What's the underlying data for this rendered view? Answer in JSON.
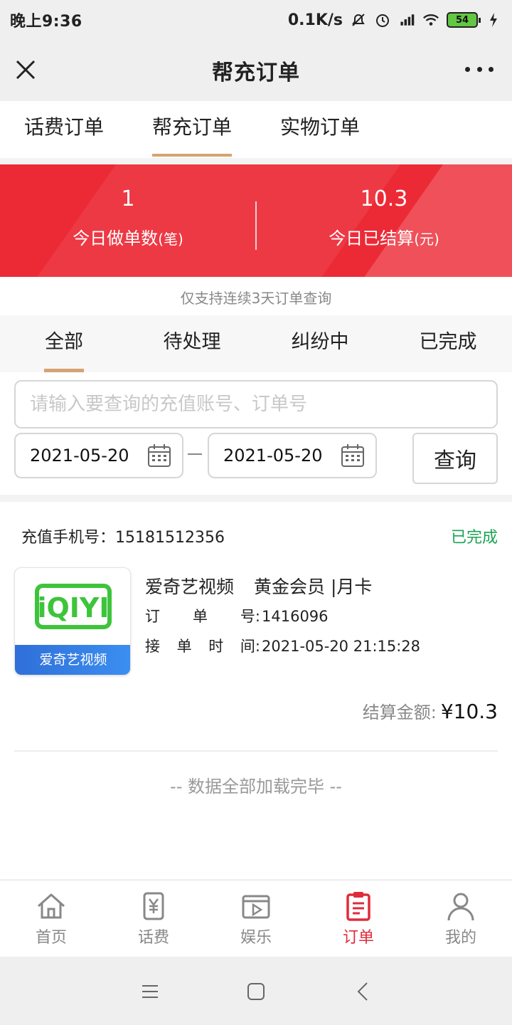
{
  "status_bar": {
    "time": "晚上9:36",
    "net_speed": "0.1K/s",
    "battery": "54"
  },
  "header": {
    "title": "帮充订单",
    "close_icon": "close-icon",
    "more_icon": "more-icon"
  },
  "top_tabs": [
    {
      "label": "话费订单",
      "active": false
    },
    {
      "label": "帮充订单",
      "active": true
    },
    {
      "label": "实物订单",
      "active": false
    }
  ],
  "summary": {
    "orders_today_value": "1",
    "orders_today_label": "今日做单数",
    "orders_today_unit": "(笔)",
    "settled_today_value": "10.3",
    "settled_today_label": "今日已结算",
    "settled_today_unit": "(元)",
    "accent_color": "#ec2a36"
  },
  "notice": "仅支持连续3天订单查询",
  "status_tabs": [
    {
      "label": "全部",
      "active": true
    },
    {
      "label": "待处理",
      "active": false
    },
    {
      "label": "纠纷中",
      "active": false
    },
    {
      "label": "已完成",
      "active": false
    }
  ],
  "filter": {
    "search_placeholder": "请输入要查询的充值账号、订单号",
    "start_date": "2021-05-20",
    "end_date": "2021-05-20",
    "query_label": "查询"
  },
  "order": {
    "phone_label": "充值手机号：",
    "phone": "15181512356",
    "status": "已完成",
    "status_color": "#1aa352",
    "thumb_logo": "iQIYI",
    "thumb_caption": "爱奇艺视频",
    "product_name": "爱奇艺视频",
    "product_spec": "黄金会员 |月卡",
    "order_no_label_chars": [
      "订",
      "单",
      "号"
    ],
    "order_no": "1416096",
    "time_label_chars": [
      "接",
      "单",
      "时",
      "间"
    ],
    "time": "2021-05-20 21:15:28",
    "settle_label": "结算金额:",
    "settle_amount": "¥10.3"
  },
  "end_text": "-- 数据全部加载完毕 --",
  "bottom_nav": [
    {
      "label": "首页",
      "icon": "home-icon",
      "active": false
    },
    {
      "label": "话费",
      "icon": "phone-bill-icon",
      "active": false
    },
    {
      "label": "娱乐",
      "icon": "video-icon",
      "active": false
    },
    {
      "label": "订单",
      "icon": "clipboard-icon",
      "active": true
    },
    {
      "label": "我的",
      "icon": "user-icon",
      "active": false
    }
  ]
}
